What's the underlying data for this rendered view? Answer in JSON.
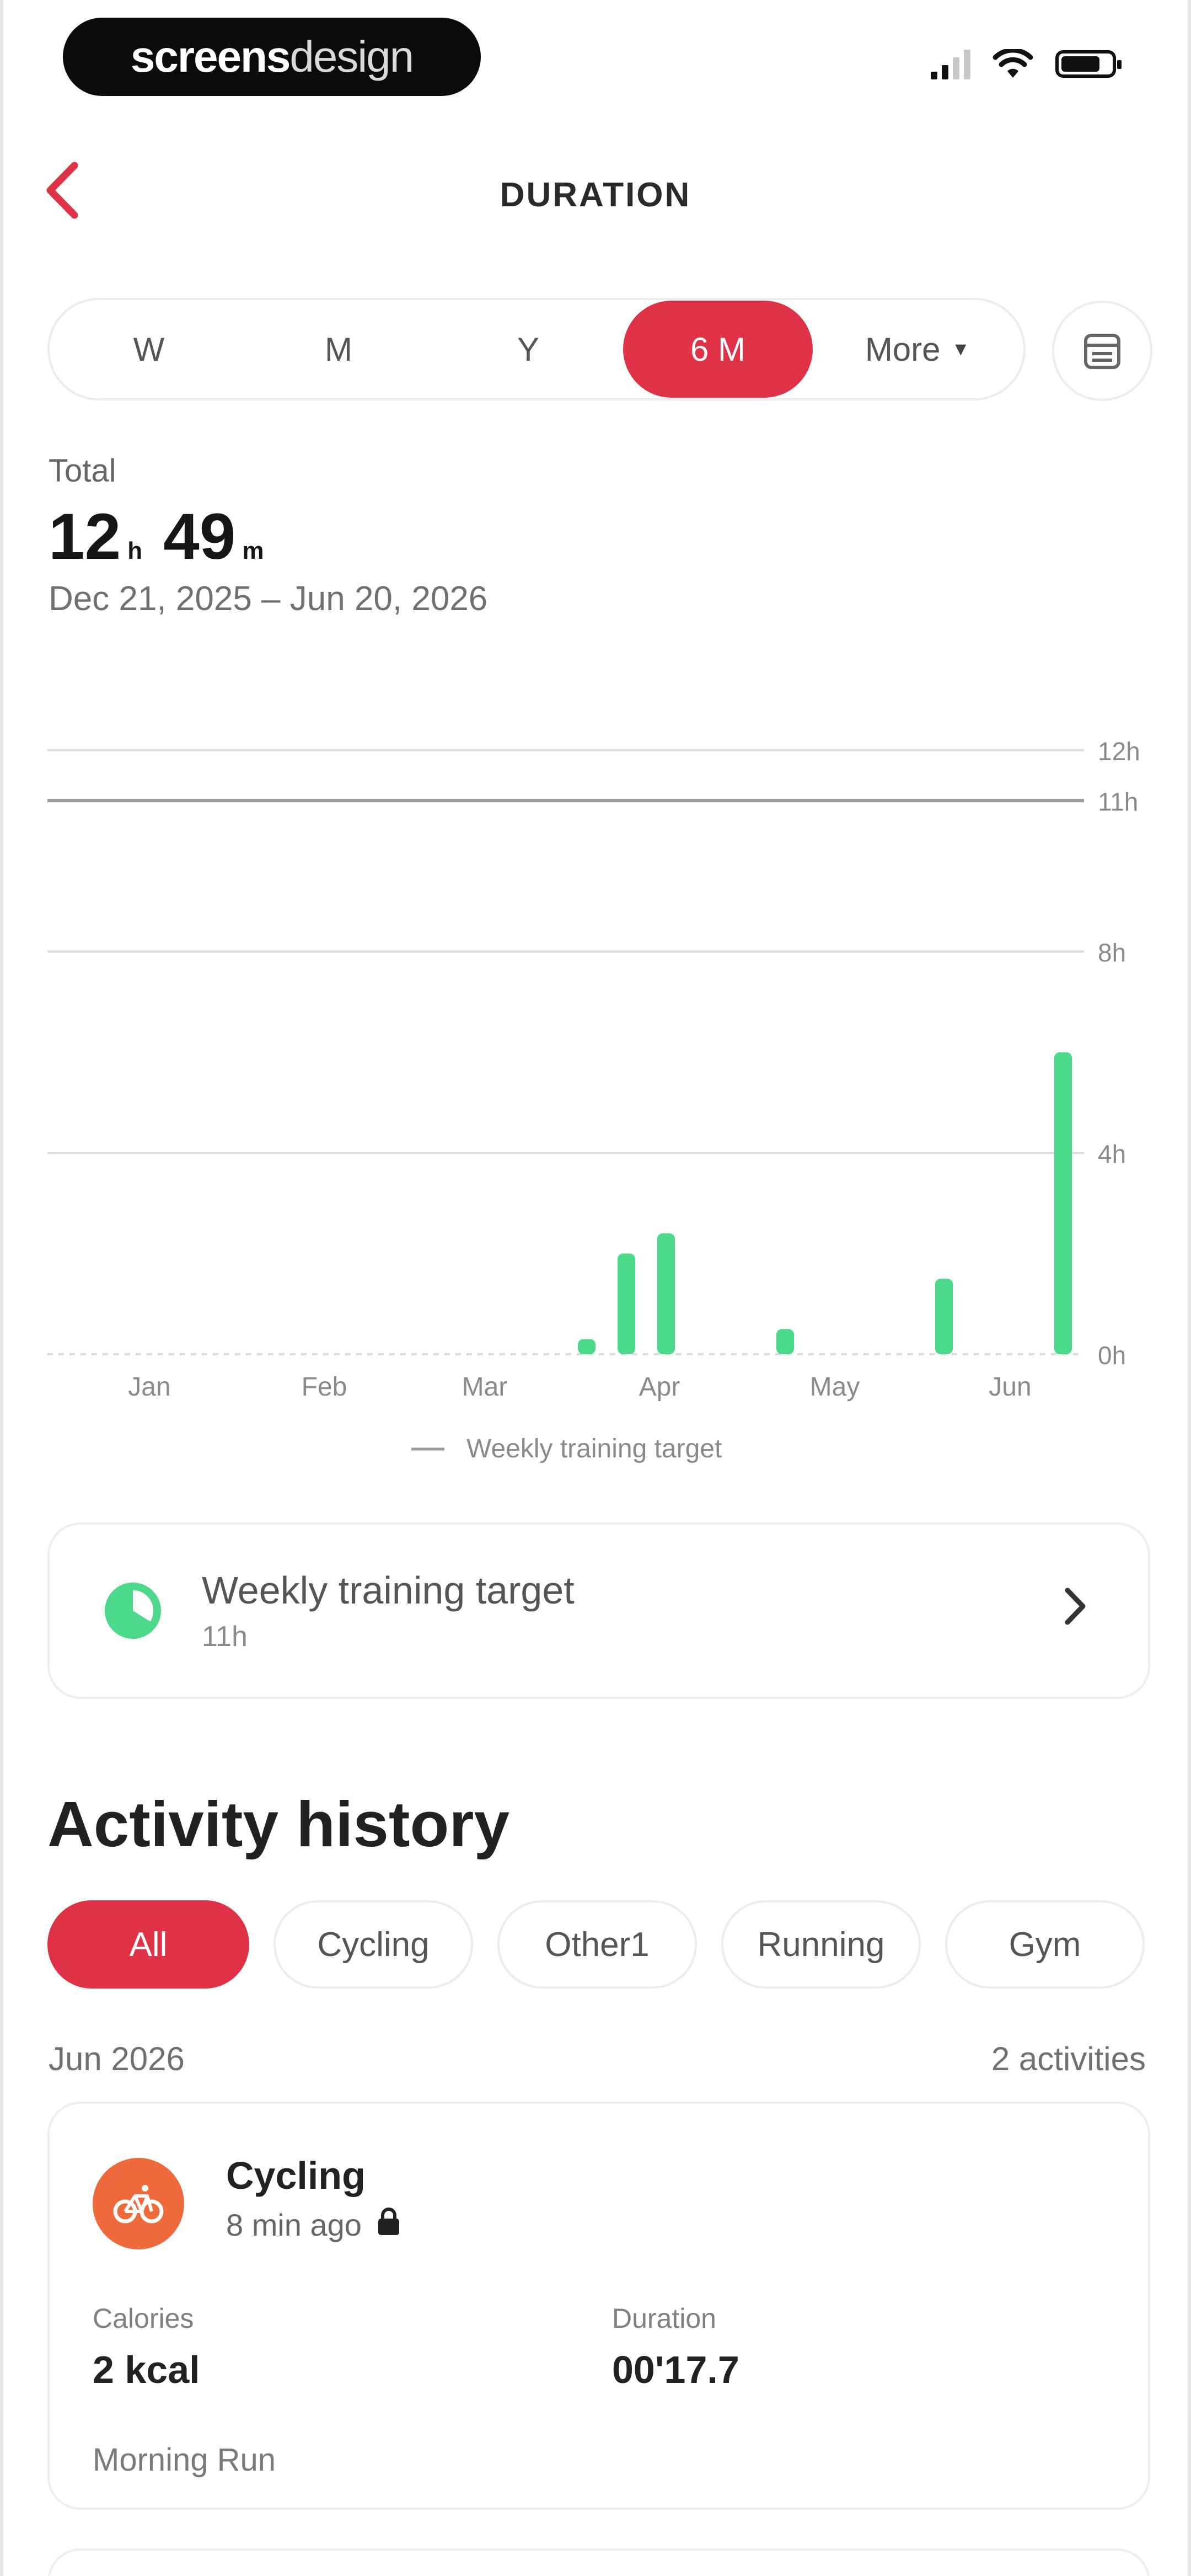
{
  "status_bar": {
    "watermark_bold": "screens",
    "watermark_light": "design"
  },
  "header": {
    "title": "DURATION"
  },
  "range_selector": {
    "options": [
      "W",
      "M",
      "Y",
      "6 M"
    ],
    "selected": "6 M",
    "more_label": "More"
  },
  "summary": {
    "label": "Total",
    "hours": "12",
    "hours_unit": "h",
    "minutes": "49",
    "minutes_unit": "m",
    "date_range": "Dec 21, 2025 – Jun 20, 2026"
  },
  "chart_data": {
    "type": "bar",
    "categories": [
      "Mar wk4",
      "Mar wk5",
      "Apr wk1",
      "Apr wk3",
      "May wk4",
      "Jun wk3"
    ],
    "x_ticks": [
      "Jan",
      "Feb",
      "Mar",
      "Apr",
      "May",
      "Jun"
    ],
    "y_ticks": [
      "0h",
      "4h",
      "8h",
      "11h",
      "12h"
    ],
    "values": [
      0.3,
      2.0,
      2.4,
      0.5,
      1.5,
      6.0
    ],
    "ylim": [
      0,
      12
    ],
    "target": 11,
    "target_label": "Weekly training target",
    "bar_color": "#4cd98a",
    "grid": true
  },
  "target_card": {
    "title": "Weekly training target",
    "value": "11h"
  },
  "history": {
    "title": "Activity history",
    "filters": [
      "All",
      "Cycling",
      "Other1",
      "Running",
      "Gym"
    ],
    "selected_filter": "All",
    "month": "Jun 2026",
    "count": "2 activities",
    "activity": {
      "icon": "bicycle-icon",
      "name": "Cycling",
      "time": "8 min ago",
      "calories_label": "Calories",
      "calories_value": "2 kcal",
      "duration_label": "Duration",
      "duration_value": "00'17.7",
      "note": "Morning Run"
    }
  },
  "colors": {
    "accent": "#e03246",
    "chart_bar": "#4cd98a",
    "activity_icon_bg": "#ef6a3a"
  }
}
